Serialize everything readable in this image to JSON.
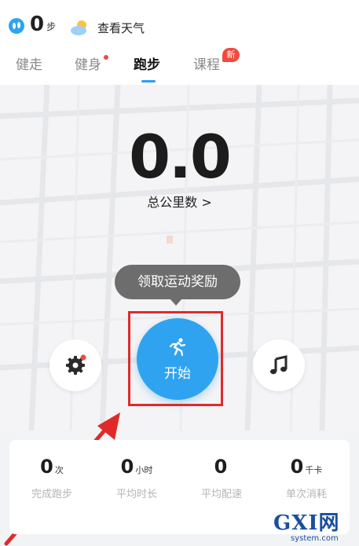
{
  "header": {
    "steps_value": "0",
    "steps_unit": "步",
    "weather_text": "查看天气",
    "steps_icon": "footprints-icon",
    "weather_icon": "partly-cloudy-icon"
  },
  "tabs": [
    {
      "label": "健走",
      "active": false,
      "dot": false
    },
    {
      "label": "健身",
      "active": false,
      "dot": true
    },
    {
      "label": "跑步",
      "active": true,
      "dot": false
    },
    {
      "label": "课程",
      "active": false,
      "dot": false,
      "badge": "新"
    }
  ],
  "main": {
    "distance_value": "0.0",
    "distance_label": "总公里数 >",
    "tooltip": "领取运动奖励",
    "start_label": "开始",
    "settings_icon": "gear-icon",
    "music_icon": "music-note-icon",
    "start_icon": "running-man-icon"
  },
  "stats": [
    {
      "value": "0",
      "unit": "次",
      "label": "完成跑步"
    },
    {
      "value": "0",
      "unit": "小时",
      "label": "平均时长"
    },
    {
      "value": "0",
      "unit": "",
      "label": "平均配速"
    },
    {
      "value": "0",
      "unit": "千卡",
      "label": "单次消耗"
    }
  ],
  "watermark": {
    "brand": "GXI网",
    "domain": "system.com"
  },
  "colors": {
    "accent": "#2fa3f0",
    "highlight": "#e02a2a",
    "badge": "#f04b3e"
  }
}
